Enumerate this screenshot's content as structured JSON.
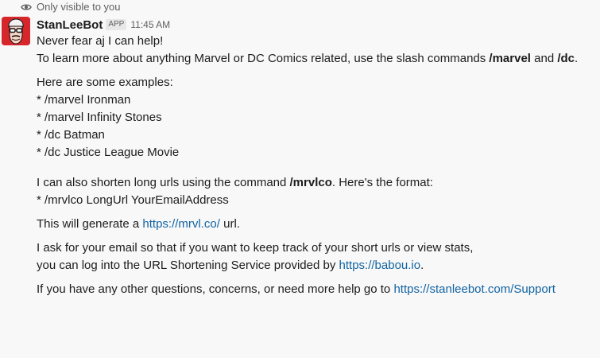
{
  "notice": {
    "text": "Only visible to you",
    "icon": "eye-icon"
  },
  "message": {
    "username": "StanLeeBot",
    "badge": "APP",
    "time": "11:45 AM",
    "line1": "Never fear aj I can help!",
    "intro_pre": "To learn more about anything Marvel or DC Comics related, use the slash commands ",
    "intro_cmd1": "/marvel",
    "intro_mid": " and ",
    "intro_cmd2": "/dc",
    "intro_post": ".",
    "examples_heading": "Here are some examples:",
    "examples": [
      "* /marvel Ironman",
      "* /marvel Infinity Stones",
      "* /dc Batman",
      "* /dc Justice League Movie"
    ],
    "shorten_pre": "I can also shorten long urls using the command ",
    "shorten_cmd": "/mrvlco",
    "shorten_post": ". Here's the format:",
    "shorten_format": "* /mrvlco LongUrl YourEmailAddress",
    "generate_pre": "This will generate a ",
    "generate_link": "https://mrvl.co/",
    "generate_post": " url.",
    "email_line1": "I ask for your email so that if you want to keep track of your short urls or view stats,",
    "email_line2_pre": "you can log into the URL Shortening Service provided by ",
    "email_link": "https://babou.io",
    "email_line2_post": ".",
    "support_pre": "If you have any other questions, concerns, or need more help go to ",
    "support_link": "https://stanleebot.com/Support"
  },
  "colors": {
    "link": "#1264a3",
    "avatar_bg": "#d7262b",
    "muted": "#616061"
  }
}
